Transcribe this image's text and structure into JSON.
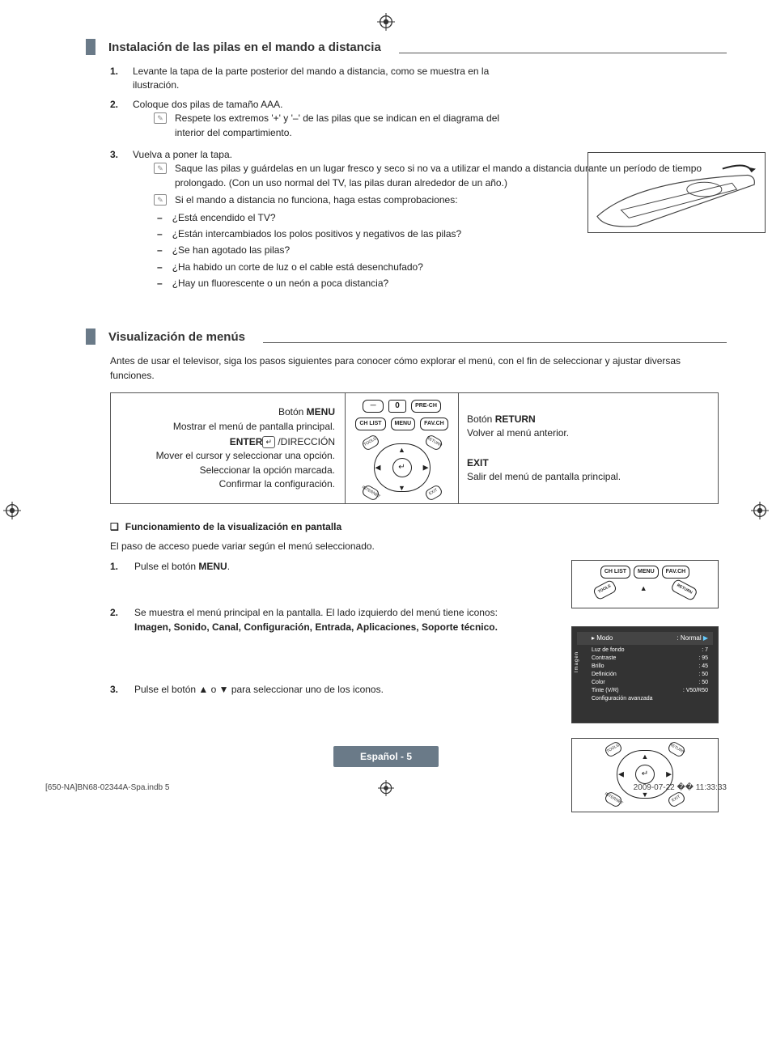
{
  "section1": {
    "title": "Instalación de las pilas en el mando a distancia",
    "steps": [
      {
        "num": "1.",
        "text": "Levante la tapa de la parte posterior del mando a distancia, como se muestra en la ilustración."
      },
      {
        "num": "2.",
        "text": "Coloque dos pilas de tamaño AAA.",
        "notes": [
          "Respete los extremos '+' y '–' de las pilas que se indican en el diagrama del interior del compartimiento."
        ]
      },
      {
        "num": "3.",
        "text": "Vuelva a poner la tapa.",
        "notes": [
          "Saque las pilas y guárdelas en un lugar fresco y seco si no va a utilizar el mando a distancia durante un período de tiempo prolongado. (Con un uso normal del TV, las pilas duran alrededor de un año.)",
          "Si el mando a distancia no funciona, haga estas comprobaciones:"
        ],
        "checks": [
          "¿Está encendido el TV?",
          "¿Están intercambiados los polos positivos y negativos de las pilas?",
          "¿Se han agotado las pilas?",
          "¿Ha habido un corte de luz o el cable está desenchufado?",
          "¿Hay un fluorescente o un neón a poca distancia?"
        ]
      }
    ]
  },
  "section2": {
    "title": "Visualización de menús",
    "intro": "Antes de usar el televisor, siga los pasos siguientes para conocer cómo explorar el menú, con el fin de seleccionar y ajustar diversas funciones.",
    "labels": {
      "menu_title": "Botón MENU",
      "menu_desc": "Mostrar el menú de pantalla principal.",
      "enter_title": "ENTER",
      "enter_suffix": "/DIRECCIÓN",
      "enter_l1": "Mover el cursor y seleccionar una opción.",
      "enter_l2": "Seleccionar la opción marcada.",
      "enter_l3": "Confirmar la configuración.",
      "return_title": "Botón RETURN",
      "return_desc": "Volver al menú anterior.",
      "exit_title": "EXIT",
      "exit_desc": "Salir del menú de pantalla principal."
    },
    "remote_buttons": {
      "minus": "—",
      "zero": "0",
      "pre_ch": "PRE-CH",
      "ch_list": "CH LIST",
      "menu": "MENU",
      "fav_ch": "FAV.CH",
      "tools": "TOOLS",
      "return": "RETURN",
      "internet": "INTERNET",
      "exit": "EXIT",
      "enter_sym": "↵"
    },
    "op_title": "Funcionamiento de la visualización en pantalla",
    "op_intro": "El paso de acceso puede variar según el menú seleccionado.",
    "op_steps": [
      {
        "num": "1.",
        "text_prefix": "Pulse el botón ",
        "text_bold": "MENU",
        "text_suffix": "."
      },
      {
        "num": "2.",
        "text_prefix": "Se muestra el menú principal en la pantalla. El lado izquierdo del menú tiene iconos: ",
        "text_bold": "Imagen, Sonido, Canal, Configuración, Entrada, Aplicaciones, Soporte técnico.",
        "text_suffix": ""
      },
      {
        "num": "3.",
        "text_prefix": "Pulse el botón ▲ o ▼ para seleccionar uno de los iconos.",
        "text_bold": "",
        "text_suffix": ""
      }
    ],
    "osd": {
      "head_left": "Modo",
      "head_right": ": Normal",
      "rows": [
        {
          "l": "Luz de fondo",
          "r": ": 7"
        },
        {
          "l": "Contraste",
          "r": ": 95"
        },
        {
          "l": "Brillo",
          "r": ": 45"
        },
        {
          "l": "Definición",
          "r": ": 50"
        },
        {
          "l": "Color",
          "r": ": 50"
        },
        {
          "l": "Tinte (V/R)",
          "r": ": V50/R50"
        },
        {
          "l": "Configuración avanzada",
          "r": ""
        }
      ],
      "side_label": "Imagen"
    }
  },
  "footer": {
    "page_label": "Español - 5",
    "file": "[650-NA]BN68-02344A-Spa.indb   5",
    "date": "2009-07-22   �� 11:33:33"
  }
}
